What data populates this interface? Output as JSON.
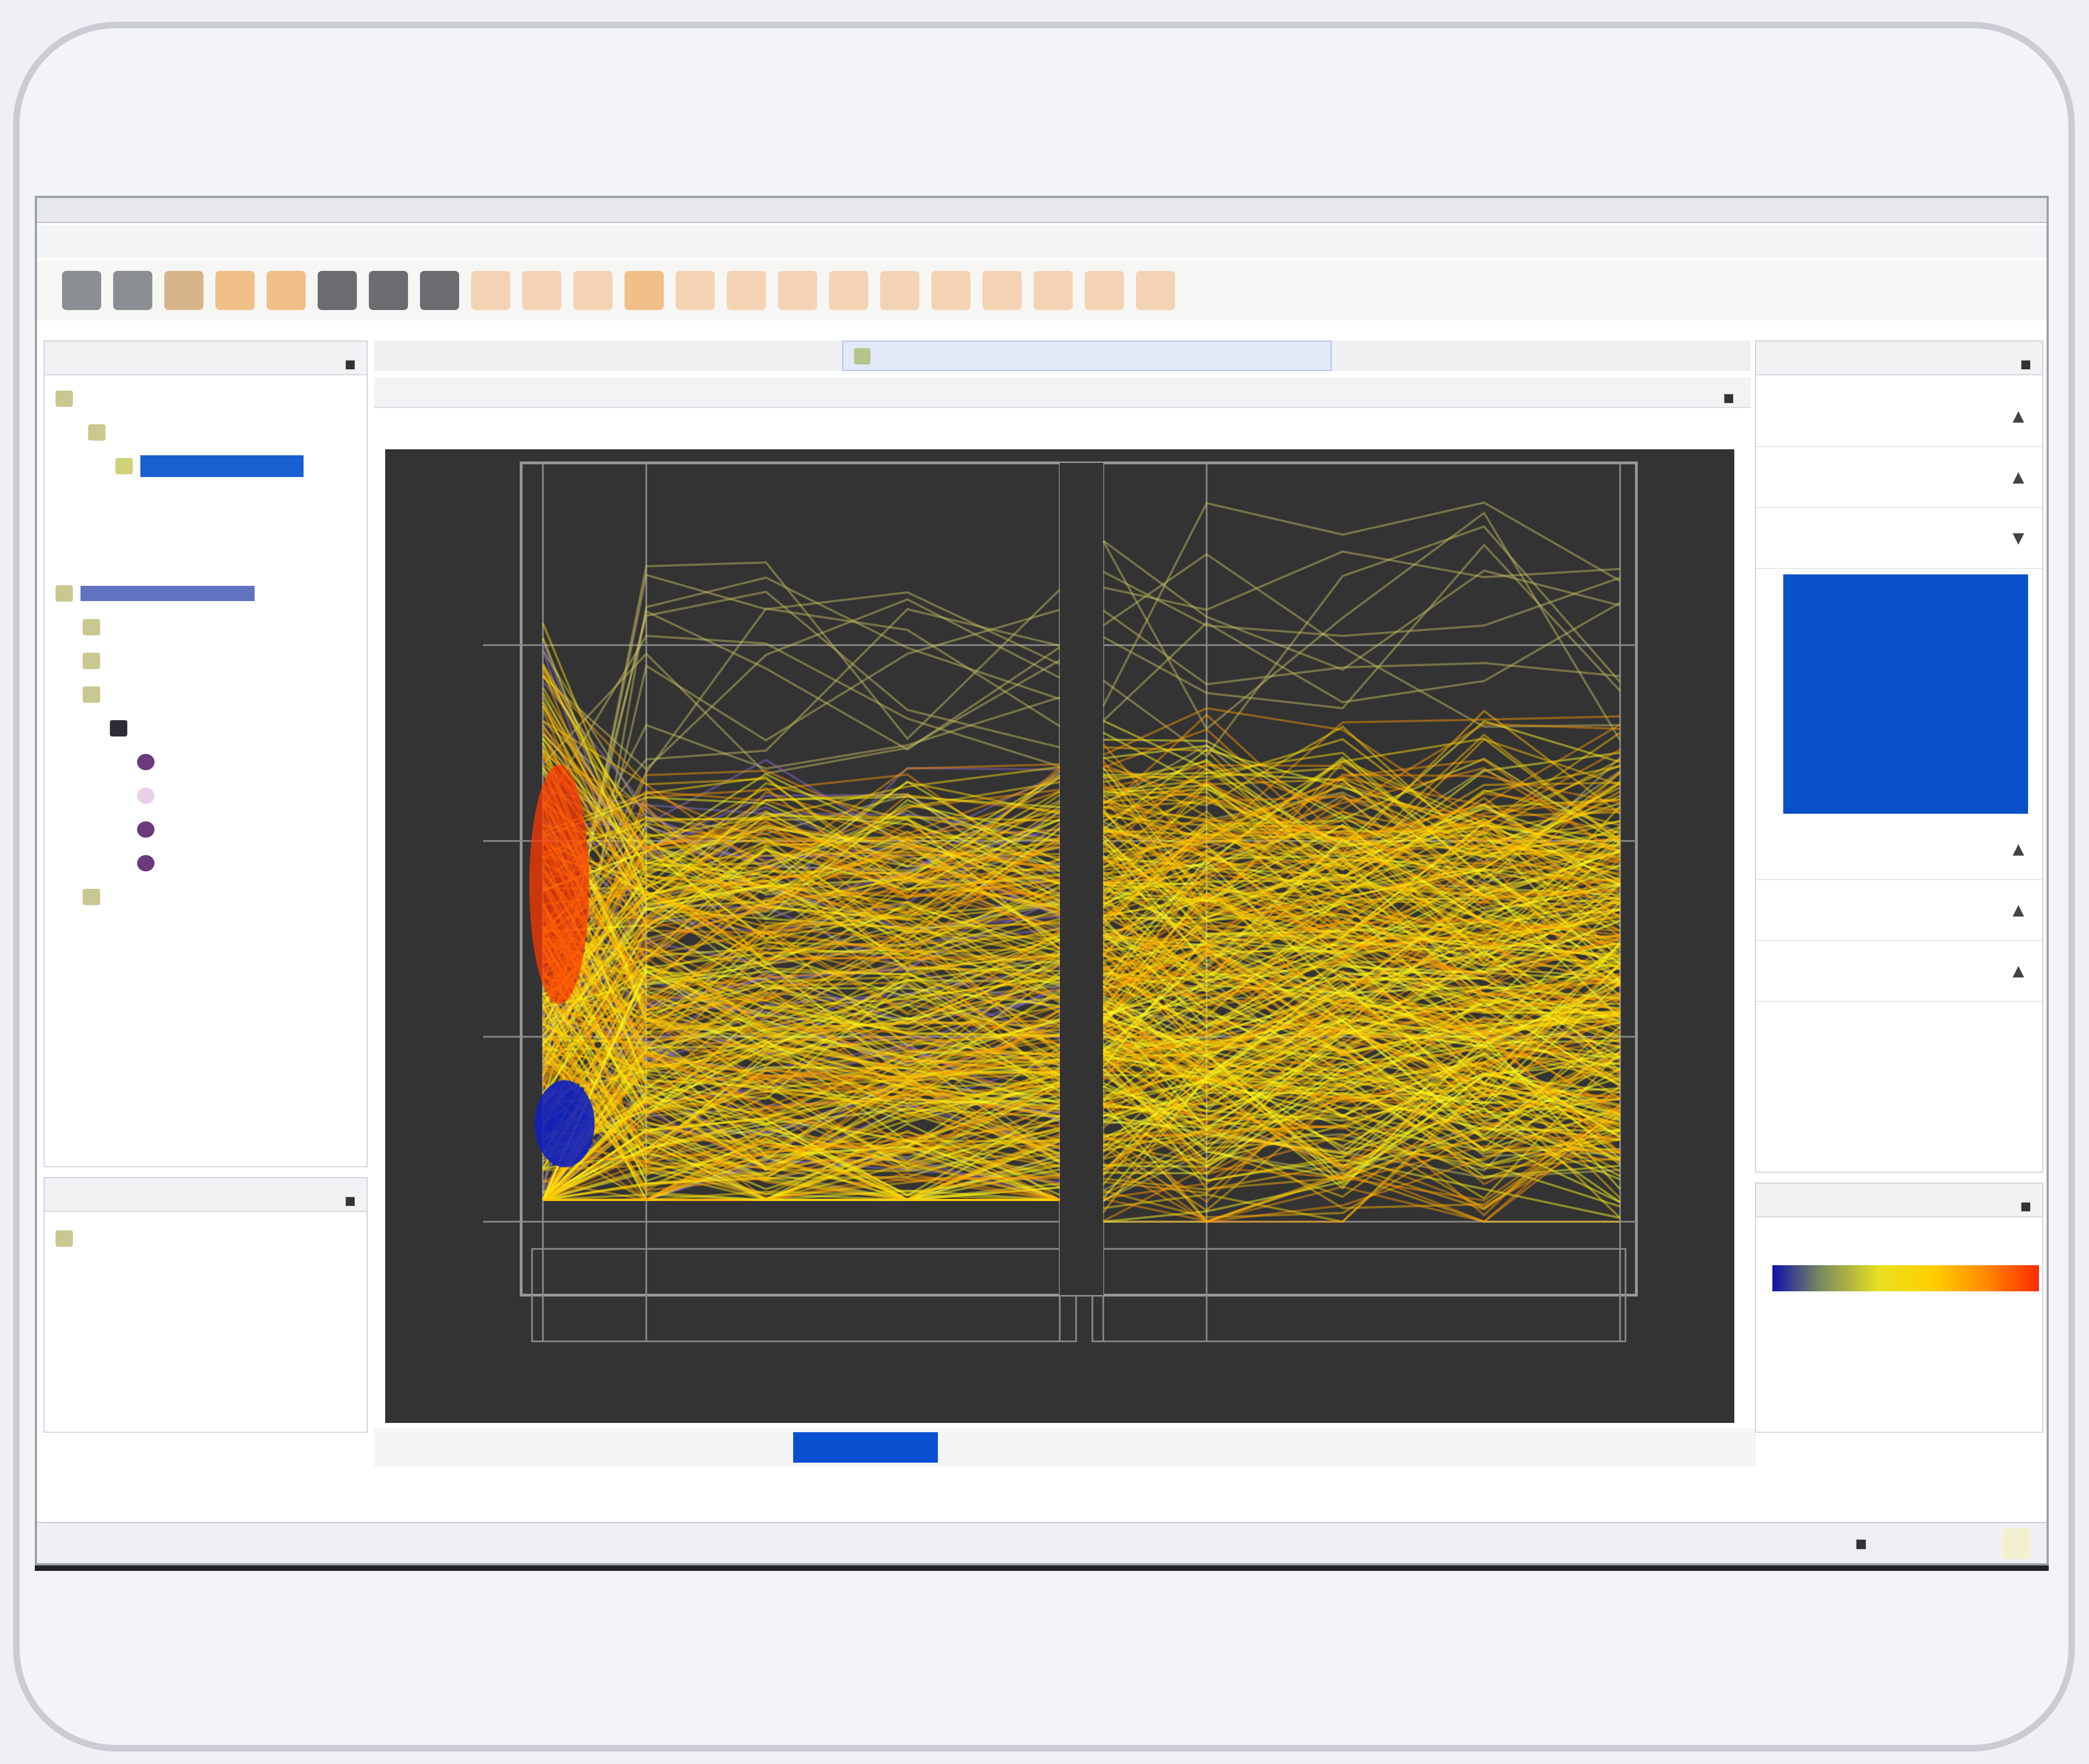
{
  "window": {
    "title": ""
  },
  "menu": [],
  "toolbar": {
    "icons": [
      "gray",
      "gray",
      "tan",
      "orange",
      "orange",
      "dark",
      "dark",
      "dark",
      "pale",
      "pale",
      "pale",
      "orange",
      "pale",
      "pale",
      "pale",
      "pale",
      "pale",
      "pale",
      "pale",
      "pale",
      "pale",
      "pale"
    ]
  },
  "left": {
    "project_navigator": {
      "title": "",
      "rows": []
    },
    "experiment_tree": {
      "rows": []
    },
    "bottom_panel": {
      "title": "",
      "rows": []
    }
  },
  "center": {
    "tab_title": "",
    "panel_title": "",
    "plot": {
      "background": "#333333",
      "line_colors": [
        "#ffff20",
        "#ffe000",
        "#ffc000",
        "#ff9a00",
        "#8a6ad0",
        "#c8c060"
      ],
      "x_axis_title": "",
      "y_axis_title": ""
    },
    "bottom_tabs": [
      {
        "label": "",
        "active": false
      },
      {
        "label": "",
        "active": false
      },
      {
        "label": "",
        "active": false
      },
      {
        "label": "",
        "active": true
      },
      {
        "label": "",
        "active": false
      },
      {
        "label": "",
        "active": false
      },
      {
        "label": "",
        "active": false
      },
      {
        "label": "",
        "active": false
      }
    ]
  },
  "right": {
    "workflow": {
      "title": "",
      "items": [
        {
          "label": ""
        },
        {
          "label": ""
        },
        {
          "label": ""
        },
        {
          "label": ""
        },
        {
          "label": ""
        },
        {
          "label": ""
        }
      ]
    },
    "legend": {
      "title": "",
      "colors": [
        "#1010aa",
        "#e8e020",
        "#ff8a00",
        "#ff2a00"
      ],
      "ticks": [
        "",
        "",
        ""
      ]
    }
  },
  "status": {
    "text": "",
    "clock": ""
  }
}
